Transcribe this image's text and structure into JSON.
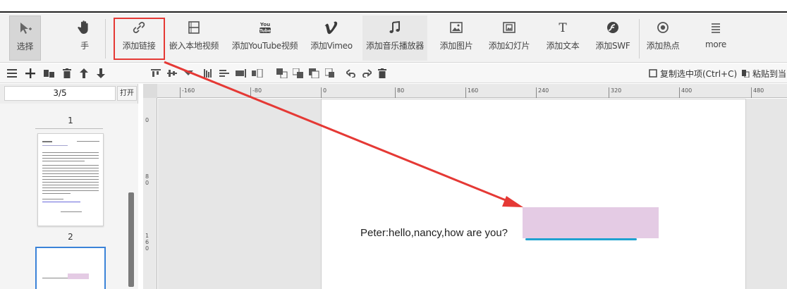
{
  "toolbar": {
    "tools": [
      {
        "label": "选择",
        "icon": "select-cursor-icon"
      },
      {
        "label": "手",
        "icon": "hand-icon"
      },
      {
        "label": "添加链接",
        "icon": "link-icon"
      },
      {
        "label": "嵌入本地视频",
        "icon": "film-icon"
      },
      {
        "label": "添加YouTube视频",
        "icon": "youtube-icon",
        "icon_text": "You Tube"
      },
      {
        "label": "添加Vimeo",
        "icon": "vimeo-icon",
        "icon_text": "V"
      },
      {
        "label": "添加音乐播放器",
        "icon": "music-note-icon"
      },
      {
        "label": "添加图片",
        "icon": "image-icon"
      },
      {
        "label": "添加幻灯片",
        "icon": "slideshow-icon"
      },
      {
        "label": "添加文本",
        "icon": "text-icon",
        "icon_text": "T"
      },
      {
        "label": "添加SWF",
        "icon": "swf-icon"
      },
      {
        "label": "添加热点",
        "icon": "hotspot-icon"
      },
      {
        "label": "more",
        "icon": "more-icon"
      }
    ]
  },
  "secondbar": {
    "copy_label": "复制选中项(Ctrl+C)",
    "paste_label": "粘贴到当"
  },
  "pages_panel": {
    "page_indicator": "3/5",
    "open_button": "打开",
    "page_numbers": [
      "1",
      "2"
    ]
  },
  "ruler": {
    "h_labels": [
      "-160",
      "-80",
      "0",
      "80",
      "160",
      "240",
      "320",
      "400",
      "480"
    ],
    "v_labels": [
      "0",
      "8\n0",
      "1\n6\n0"
    ]
  },
  "canvas": {
    "text": "Peter:hello,nancy,how are you?"
  },
  "colors": {
    "annotation_red": "#e53935",
    "link_area": "#e4cbe4",
    "link_underline": "#1fa2d0",
    "selected_thumb_border": "#3b83d8"
  }
}
